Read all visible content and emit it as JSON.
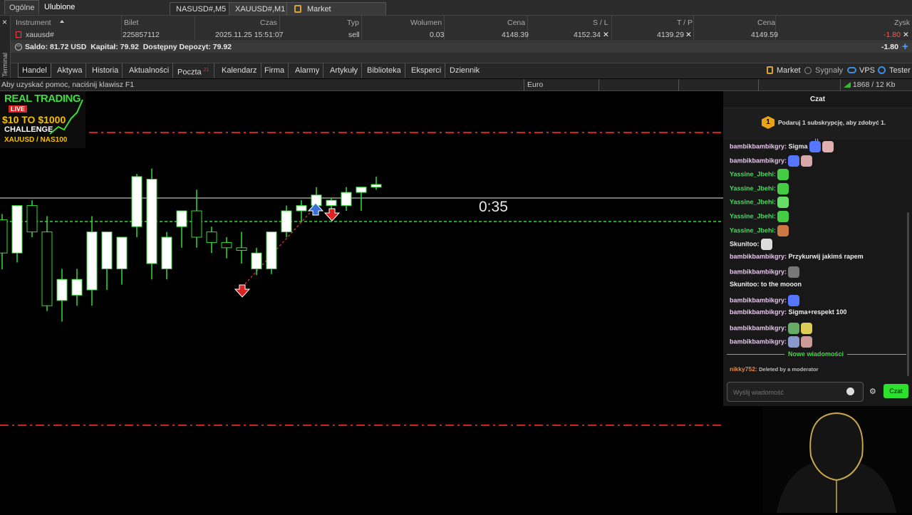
{
  "top_tabs": {
    "general": "Ogólne",
    "favorites": "Ulubione"
  },
  "chart_tabs": [
    {
      "label": "NASUSD#,M5"
    },
    {
      "label": "XAUUSD#,M1"
    },
    {
      "label": "Market"
    }
  ],
  "terminal": {
    "side_label": "Terminal",
    "close_label": "×",
    "columns": [
      "Instrument",
      "Bilet",
      "Czas",
      "Typ",
      "Wolumen",
      "Cena",
      "S / L",
      "T / P",
      "Cena",
      "Zysk"
    ],
    "row": {
      "instrument": "xauusd#",
      "ticket": "225857112",
      "time": "2025.11.25 15:51:07",
      "type": "sell",
      "volume": "0.03",
      "price": "4148.39",
      "sl": "4152.34",
      "tp": "4139.29",
      "current_price": "4149.59",
      "profit": "-1.80"
    },
    "summary": {
      "text": "Saldo: 81.72 USD  Kapitał: 79.92  Dostępny Depozyt: 79.92",
      "profit": "-1.80"
    },
    "tabs": [
      "Handel",
      "Aktywa",
      "Historia",
      "Aktualności",
      "Poczta",
      "Kalendarz",
      "Firma",
      "Alarmy",
      "Artykuły",
      "Biblioteka",
      "Eksperci",
      "Dziennik"
    ],
    "mail_badge": "21",
    "right_buttons": [
      "Market",
      "Sygnały",
      "VPS",
      "Tester"
    ]
  },
  "statusbar": {
    "help": "Aby uzyskać pomoc, naciśnij klawisz F1",
    "profile": "Euro",
    "traffic": "1868 / 12 Kb"
  },
  "chart": {
    "timer": "0:35",
    "up_color": "#ffffff",
    "wick_color": "#33dd33",
    "level_red": "#cc2222",
    "level_green": "#33dd33",
    "candles": [
      {
        "o": 53.3,
        "h": 54.4,
        "l": 43.9,
        "c": 47.0
      },
      {
        "o": 47.0,
        "h": 56.0,
        "l": 45.2,
        "c": 56.0
      },
      {
        "o": 56.0,
        "h": 57.0,
        "l": 50.0,
        "c": 51.0
      },
      {
        "o": 51.0,
        "h": 54.0,
        "l": 36.0,
        "c": 37.0
      },
      {
        "o": 38.0,
        "h": 44.0,
        "l": 34.0,
        "c": 42.0
      },
      {
        "o": 39.0,
        "h": 44.0,
        "l": 37.0,
        "c": 42.0
      },
      {
        "o": 40.0,
        "h": 54.0,
        "l": 37.0,
        "c": 51.0
      },
      {
        "o": 44.0,
        "h": 51.0,
        "l": 40.0,
        "c": 51.0
      },
      {
        "o": 44.0,
        "h": 50.0,
        "l": 41.0,
        "c": 50.0
      },
      {
        "o": 52.0,
        "h": 62.0,
        "l": 50.0,
        "c": 61.5
      },
      {
        "o": 45.0,
        "h": 63.0,
        "l": 42.0,
        "c": 61.0
      },
      {
        "o": 44.0,
        "h": 51.0,
        "l": 42.0,
        "c": 50.0
      },
      {
        "o": 52.0,
        "h": 55.0,
        "l": 48.0,
        "c": 55.0
      },
      {
        "o": 55.0,
        "h": 59.0,
        "l": 48.0,
        "c": 50.0
      },
      {
        "o": 51.0,
        "h": 52.0,
        "l": 47.0,
        "c": 49.0
      },
      {
        "o": 49.0,
        "h": 50.0,
        "l": 46.0,
        "c": 48.0
      },
      {
        "o": 48.0,
        "h": 51.0,
        "l": 45.0,
        "c": 47.5
      },
      {
        "o": 44.0,
        "h": 48.0,
        "l": 42.8,
        "c": 47.0
      },
      {
        "o": 44.0,
        "h": 51.0,
        "l": 43.0,
        "c": 51.0
      },
      {
        "o": 51.0,
        "h": 56.0,
        "l": 50.0,
        "c": 55.0
      },
      {
        "o": 55.0,
        "h": 57.0,
        "l": 53.0,
        "c": 56.0
      },
      {
        "o": 56.0,
        "h": 59.5,
        "l": 55.0,
        "c": 58.0
      },
      {
        "o": 56.0,
        "h": 57.5,
        "l": 55.0,
        "c": 57.0
      },
      {
        "o": 56.0,
        "h": 59.5,
        "l": 55.0,
        "c": 58.5
      },
      {
        "o": 58.5,
        "h": 59.5,
        "l": 55.0,
        "c": 59.5
      },
      {
        "o": 59.5,
        "h": 61.5,
        "l": 59.0,
        "c": 60.0
      }
    ]
  },
  "stream_overlay": {
    "line1": "REAL TRADING",
    "live": "LIVE",
    "line2": "$10 TO $1000",
    "line3": "CHALLENGE",
    "line4": "XAUUSD / NAS100"
  },
  "chat": {
    "title": "Czat",
    "sub_badge": "1",
    "sub_text": "Podaruj 1 subskrypcję, aby zdobyć 1.",
    "messages": [
      {
        "user": "bambikbambikgry:",
        "text": "Sigma",
        "color": "#e9c7f0",
        "emotes": [
          "#5577ff",
          "#e0b0b0"
        ]
      },
      {
        "user": "bambikbambikgry:",
        "text": "",
        "color": "#e9c7f0",
        "emotes": [
          "#5577ff",
          "#d8a8a8"
        ]
      },
      {
        "user": "Yassine_Jbehi:",
        "text": "",
        "color": "#4cd964",
        "emotes": [
          "#44cc44"
        ]
      },
      {
        "user": "Yassine_Jbehi:",
        "text": "",
        "color": "#4cd964",
        "emotes": [
          "#44cc44"
        ]
      },
      {
        "user": "Yassine_Jbehi:",
        "text": "",
        "color": "#4cd964",
        "emotes": [
          "#66dd66"
        ]
      },
      {
        "user": "Yassine_Jbehi:",
        "text": "",
        "color": "#4cd964",
        "emotes": [
          "#44cc44"
        ]
      },
      {
        "user": "Yassine_Jbehi:",
        "text": "",
        "color": "#4cd964",
        "emotes": [
          "#cc7744"
        ]
      },
      {
        "user": "Skunitoo:",
        "text": "",
        "color": "#f0f0f0",
        "emotes": [
          "#dddddd"
        ]
      },
      {
        "user": "bambikbambikgry:",
        "text": "Przykurwij jakimś rapem",
        "color": "#e9c7f0",
        "emotes": []
      },
      {
        "user": "bambikbambikgry:",
        "text": "",
        "color": "#e9c7f0",
        "emotes": [
          "#777777"
        ]
      },
      {
        "user": "Skunitoo:",
        "text": "to the mooon",
        "color": "#f0f0f0",
        "emotes": []
      },
      {
        "user": "bambikbambikgry:",
        "text": "",
        "color": "#e9c7f0",
        "emotes": [
          "#5577ff"
        ]
      },
      {
        "user": "bambikbambikgry:",
        "text": "Sigma+respekt 100",
        "color": "#e9c7f0",
        "emotes": []
      },
      {
        "user": "bambikbambikgry:",
        "text": "",
        "color": "#e9c7f0",
        "emotes": [
          "#66aa66",
          "#ddcc55"
        ]
      },
      {
        "user": "bambikbambikgry:",
        "text": "",
        "color": "#e9c7f0",
        "emotes": [
          "#8899cc",
          "#cc9999"
        ]
      }
    ],
    "new_messages_label": "Nowe wiadomości",
    "last": {
      "user": "nikky752:",
      "text": "Deleted by a moderator"
    },
    "input_placeholder": "Wyślij wiadomość",
    "send_label": "Czat"
  }
}
